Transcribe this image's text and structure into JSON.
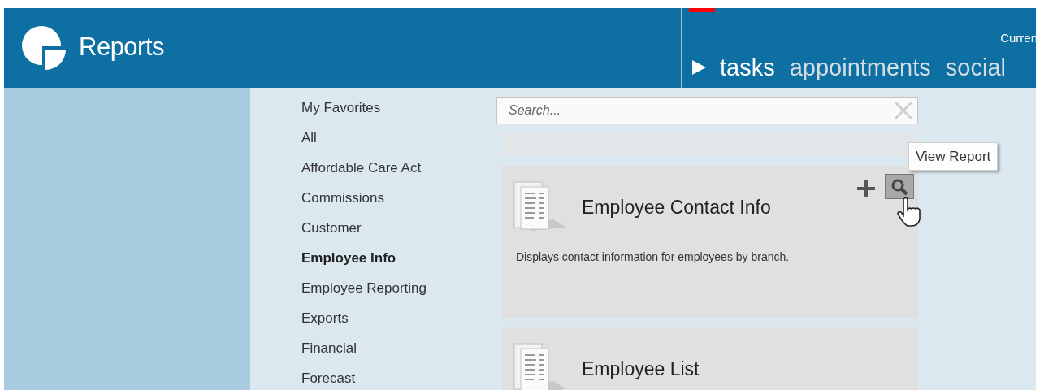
{
  "header": {
    "title": "Reports",
    "current_label": "Curren",
    "nav": [
      {
        "label": "tasks",
        "selected": true
      },
      {
        "label": "appointments",
        "selected": false
      },
      {
        "label": "social",
        "selected": false
      }
    ]
  },
  "categories": [
    {
      "label": "My Favorites",
      "selected": false
    },
    {
      "label": "All",
      "selected": false
    },
    {
      "label": "Affordable Care Act",
      "selected": false
    },
    {
      "label": "Commissions",
      "selected": false
    },
    {
      "label": "Customer",
      "selected": false
    },
    {
      "label": "Employee Info",
      "selected": true
    },
    {
      "label": "Employee Reporting",
      "selected": false
    },
    {
      "label": "Exports",
      "selected": false
    },
    {
      "label": "Financial",
      "selected": false
    },
    {
      "label": "Forecast",
      "selected": false
    }
  ],
  "search": {
    "placeholder": "Search..."
  },
  "reports": [
    {
      "title": "Employee Contact Info",
      "description": "Displays contact information for employees by branch.",
      "hovered": true
    },
    {
      "title": "Employee List",
      "hovered": false
    }
  ],
  "tooltip": "View Report"
}
